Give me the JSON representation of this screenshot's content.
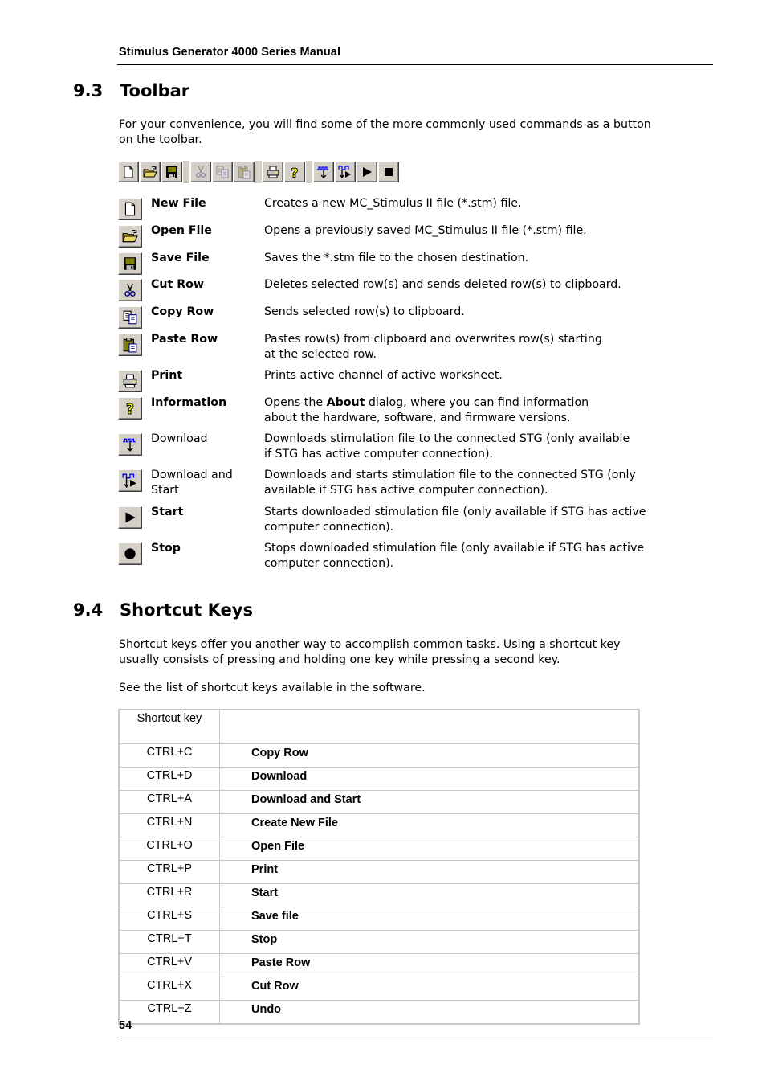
{
  "header": {
    "title": "Stimulus Generator 4000 Series Manual"
  },
  "section_toolbar": {
    "number": "9.3",
    "title": "Toolbar",
    "intro_lines": [
      "For your convenience, you will find some of the more commonly used commands as a button",
      "on the toolbar."
    ],
    "toolbar_buttons": [
      {
        "icon": "new-file-icon",
        "label": "New File",
        "enabled": true
      },
      {
        "icon": "open-file-icon",
        "label": "Open File",
        "enabled": true
      },
      {
        "icon": "save-file-icon",
        "label": "Save File",
        "enabled": true
      },
      {
        "icon": "cut-icon",
        "label": "Cut Row",
        "enabled": false
      },
      {
        "icon": "copy-icon",
        "label": "Copy Row",
        "enabled": false
      },
      {
        "icon": "paste-icon",
        "label": "Paste Row",
        "enabled": false
      },
      {
        "icon": "print-icon",
        "label": "Print",
        "enabled": true
      },
      {
        "icon": "help-icon",
        "label": "Information",
        "enabled": true
      },
      {
        "icon": "download-icon",
        "label": "Download",
        "enabled": true
      },
      {
        "icon": "download-start-icon",
        "label": "Download and Start",
        "enabled": true
      },
      {
        "icon": "play-icon",
        "label": "Start",
        "enabled": true
      },
      {
        "icon": "stop-icon",
        "label": "Stop",
        "enabled": true
      }
    ],
    "items": [
      {
        "icon": "new-file-icon",
        "name": "New File",
        "bold": true,
        "desc_lines": [
          "Creates a new MC_Stimulus II file (*.stm) file."
        ]
      },
      {
        "icon": "open-file-icon",
        "name": "Open File",
        "bold": true,
        "desc_lines": [
          "Opens a previously saved MC_Stimulus II file (*.stm) file."
        ]
      },
      {
        "icon": "save-file-icon",
        "name": "Save File",
        "bold": true,
        "desc_lines": [
          "Saves the *.stm file to the chosen destination."
        ]
      },
      {
        "icon": "cut-icon",
        "name": "Cut Row",
        "bold": true,
        "desc_lines": [
          "Deletes selected row(s) and sends deleted row(s) to clipboard."
        ]
      },
      {
        "icon": "copy-icon",
        "name": "Copy Row",
        "bold": true,
        "desc_lines": [
          "Sends selected row(s) to clipboard."
        ]
      },
      {
        "icon": "paste-icon",
        "name": "Paste Row",
        "bold": true,
        "desc_lines": [
          "Pastes row(s) from clipboard and overwrites row(s) starting",
          "at the selected row."
        ]
      },
      {
        "icon": "print-icon",
        "name": "Print",
        "bold": true,
        "desc_lines": [
          "Prints active channel of active worksheet."
        ]
      },
      {
        "icon": "help-icon",
        "name": "Information",
        "bold": true,
        "desc_pre": "Opens the ",
        "desc_bold": "About",
        "desc_post": " dialog, where you can find information",
        "desc_line2": "about the hardware, software, and firmware versions."
      },
      {
        "icon": "download-icon",
        "name": "Download",
        "bold": false,
        "desc_lines": [
          "Downloads stimulation file to the connected STG (only available",
          "if STG has active computer connection)."
        ]
      },
      {
        "icon": "download-start-icon",
        "name_lines": [
          "Download and",
          "Start"
        ],
        "bold": false,
        "desc_lines": [
          "Downloads and starts stimulation file to the connected STG (only",
          "available if STG has active computer connection)."
        ]
      },
      {
        "icon": "play-icon",
        "name": "Start",
        "bold": true,
        "desc_lines": [
          "Starts downloaded stimulation file (only available if STG has active",
          "computer connection)."
        ]
      },
      {
        "icon": "stop-icon",
        "name": "Stop",
        "bold": true,
        "desc_lines": [
          "Stops downloaded stimulation file (only available if STG has active",
          "computer connection)."
        ]
      }
    ]
  },
  "section_shortcuts": {
    "number": "9.4",
    "title": "Shortcut Keys",
    "intro_lines": [
      "Shortcut keys offer you another way to accomplish common tasks. Using a shortcut key",
      "usually consists of pressing and holding one key while pressing a second key."
    ],
    "see_list": "See the list of shortcut keys available in the software.",
    "table": {
      "header": [
        "Shortcut key",
        ""
      ],
      "rows": [
        [
          "CTRL+C",
          "Copy Row"
        ],
        [
          "CTRL+D",
          "Download"
        ],
        [
          "CTRL+A",
          "Download and Start"
        ],
        [
          "CTRL+N",
          "Create New File"
        ],
        [
          "CTRL+O",
          "Open File"
        ],
        [
          "CTRL+P",
          "Print"
        ],
        [
          "CTRL+R",
          "Start"
        ],
        [
          "CTRL+S",
          "Save file"
        ],
        [
          "CTRL+T",
          "Stop"
        ],
        [
          "CTRL+V",
          "Paste Row"
        ],
        [
          "CTRL+X",
          "Cut Row"
        ],
        [
          "CTRL+Z",
          "Undo"
        ]
      ]
    }
  },
  "footer": {
    "page_number": "54"
  }
}
